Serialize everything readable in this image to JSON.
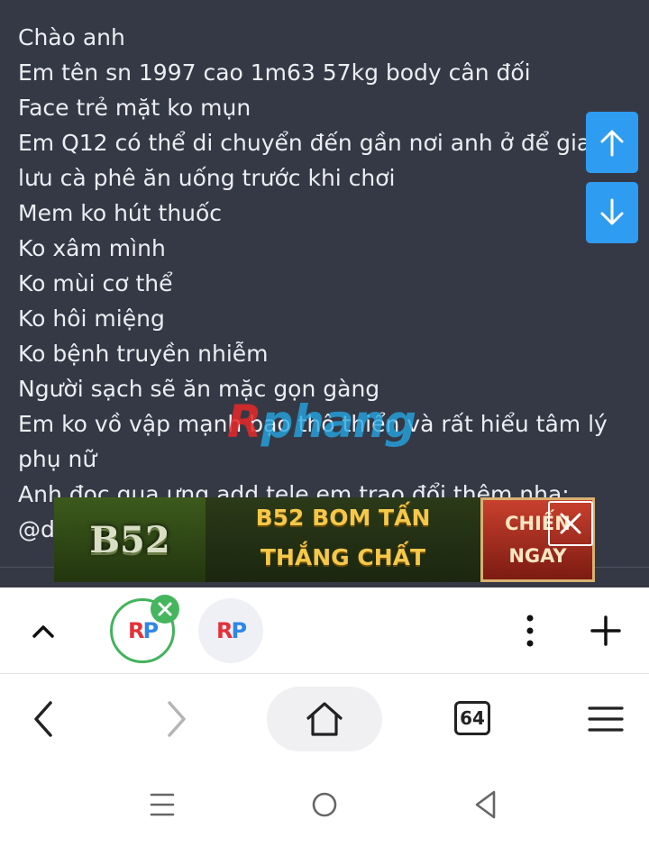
{
  "post": {
    "lines": [
      "Chào anh",
      "Em tên sn 1997 cao 1m63 57kg body cân đối",
      "Face trẻ mặt ko mụn",
      "Em Q12 có thể di chuyển đến gần nơi anh ở để giao",
      "lưu cà phê ăn uống trước khi chơi",
      "Mem ko hút thuốc",
      "Ko xâm mình",
      "Ko mùi cơ thể",
      "Ko hôi miệng",
      "Ko bệnh truyền nhiễm",
      "Người sạch sẽ ăn mặc gọn gàng",
      "Em ko vồ vập mạnh bạo thô thiển và rất hiểu tâm lý",
      "phụ nữ",
      "Anh đọc qua ưng add tele em trao đổi thêm nha:",
      "@d"
    ],
    "watermark": {
      "r": "R",
      "rest": "phang"
    }
  },
  "scroll": {
    "up_icon": "arrow-up-icon",
    "down_icon": "arrow-down-icon"
  },
  "ad": {
    "logo_text": "B52",
    "headline_1": "B52 BOM TẤN",
    "headline_2": "THẮNG CHẤT",
    "cta_1": "CHIẾN",
    "cta_2": "NGAY",
    "close_icon": "close-icon"
  },
  "tabstrip": {
    "collapse_icon": "chevron-up-icon",
    "tabs": [
      {
        "logo_r": "R",
        "logo_p": "P",
        "active": true
      },
      {
        "logo_r": "R",
        "logo_p": "P",
        "active": false
      }
    ],
    "more_icon": "more-vertical-icon",
    "add_icon": "plus-icon"
  },
  "navbar": {
    "back_icon": "chevron-left-icon",
    "forward_icon": "chevron-right-icon",
    "home_icon": "home-icon",
    "tab_count": "64",
    "menu_icon": "hamburger-menu-icon"
  },
  "colors": {
    "post_bg": "#353945",
    "post_text": "#ebedf2",
    "scroll_button": "#2e9cf1",
    "active_tab_ring": "#42b35b"
  }
}
